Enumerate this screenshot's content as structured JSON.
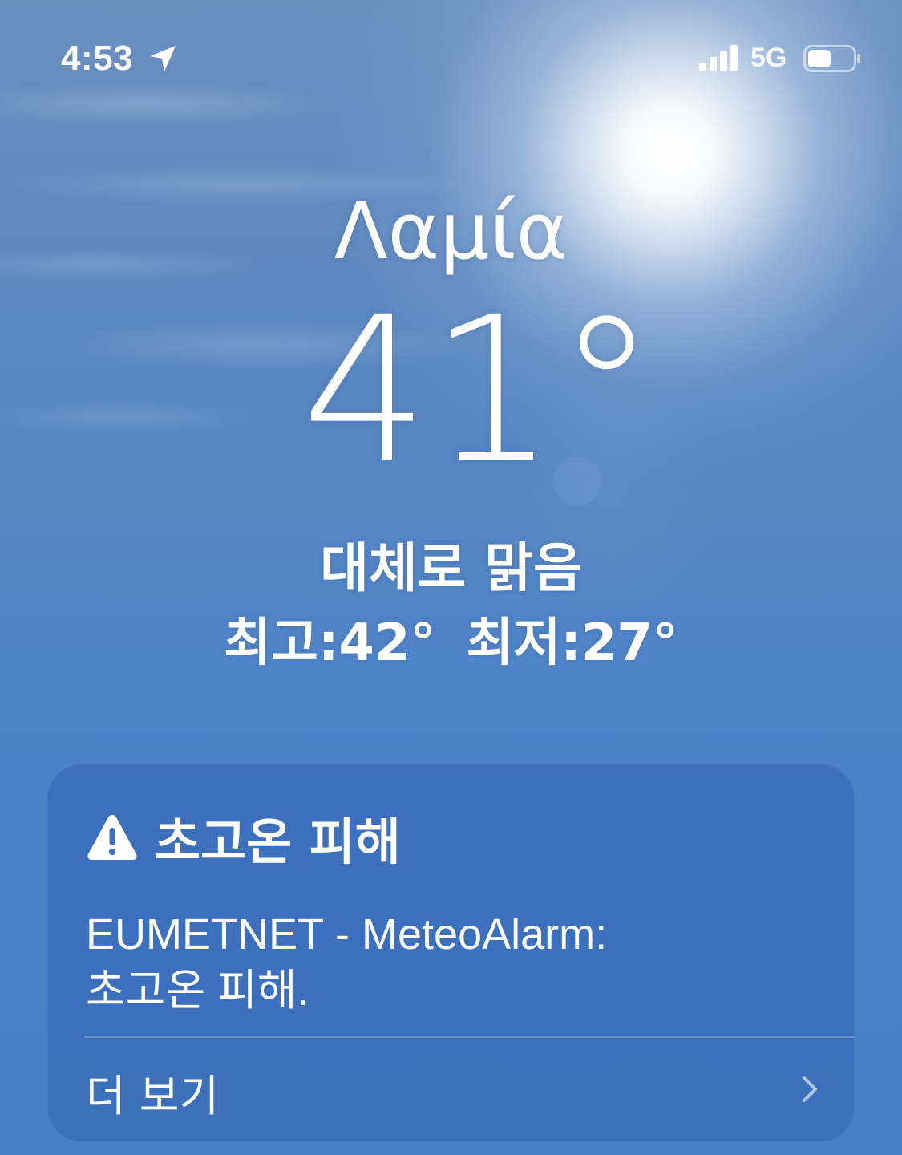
{
  "status_bar": {
    "time": "4:53",
    "network": "5G",
    "icons": [
      "location-arrow-icon",
      "signal-icon",
      "battery-icon"
    ]
  },
  "weather": {
    "city": "Λαμία",
    "temperature": "41°",
    "condition": "대체로 맑음",
    "high": "최고:42°",
    "low": "최저:27°"
  },
  "alert": {
    "icon": "warning-icon",
    "title": "초고온 피해",
    "source_line": "EUMETNET - MeteoAlarm:",
    "description": "초고온 피해.",
    "more_label": "더 보기",
    "more_icon": "chevron-right-icon"
  },
  "colors": {
    "sky_top": "#6a8fbf",
    "sky_bottom": "#4a7fc5",
    "card": "#3a6cb8",
    "text": "#ffffff"
  }
}
